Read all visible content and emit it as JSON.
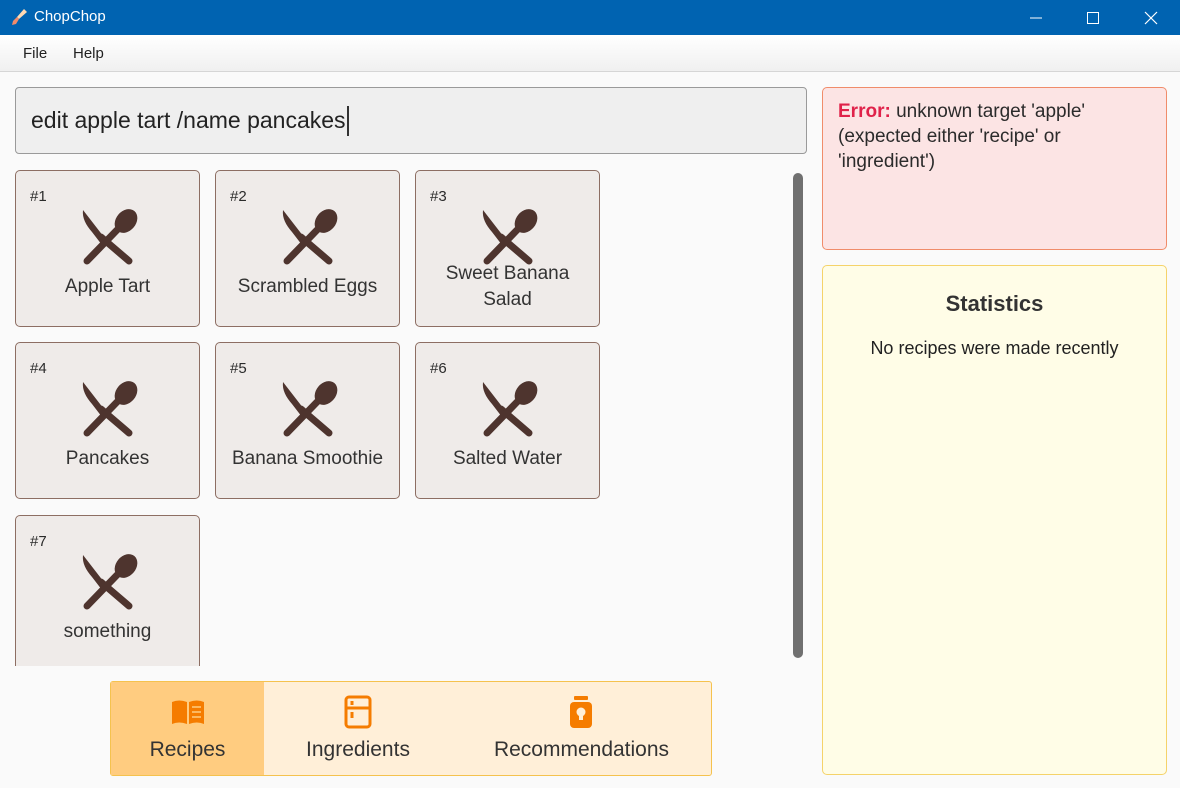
{
  "window": {
    "title": "ChopChop",
    "icon": "broom-icon"
  },
  "menu": {
    "items": [
      "File",
      "Help"
    ]
  },
  "command": {
    "value": "edit apple tart /name pancakes"
  },
  "recipes": [
    {
      "index": "#1",
      "name": "Apple Tart",
      "icon": "utensils-icon"
    },
    {
      "index": "#2",
      "name": "Scrambled Eggs",
      "icon": "utensils-icon"
    },
    {
      "index": "#3",
      "name": "Sweet Banana Salad",
      "icon": "utensils-icon"
    },
    {
      "index": "#4",
      "name": "Pancakes",
      "icon": "utensils-icon"
    },
    {
      "index": "#5",
      "name": "Banana Smoothie",
      "icon": "utensils-icon"
    },
    {
      "index": "#6",
      "name": "Salted Water",
      "icon": "utensils-icon"
    },
    {
      "index": "#7",
      "name": "something",
      "icon": "utensils-icon"
    }
  ],
  "tabs": [
    {
      "label": "Recipes",
      "icon": "book-icon",
      "active": true
    },
    {
      "label": "Ingredients",
      "icon": "fridge-icon",
      "active": false
    },
    {
      "label": "Recommendations",
      "icon": "jar-icon",
      "active": false
    }
  ],
  "error": {
    "label": "Error:",
    "message": " unknown target 'apple' (expected either 'recipe' or 'ingredient')"
  },
  "statistics": {
    "title": "Statistics",
    "message": "No recipes were made recently"
  },
  "colors": {
    "titlebar": "#0063b1",
    "card_bg": "#efebe9",
    "card_border": "#8d6e63",
    "utensil_icon": "#4e342e",
    "tab_active": "#ffcc80",
    "tab_icon": "#f57c00",
    "error_label": "#e0224a",
    "error_bg": "#fce4e4",
    "stats_bg": "#fffde7"
  }
}
